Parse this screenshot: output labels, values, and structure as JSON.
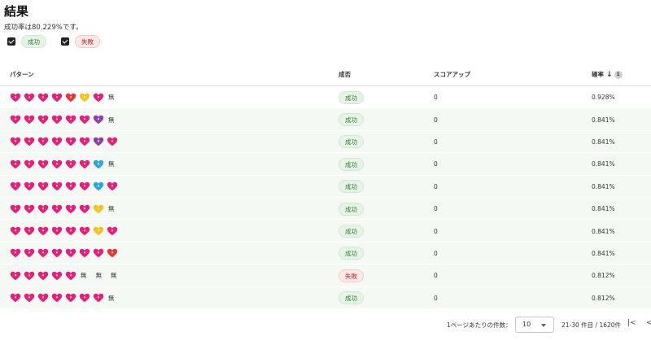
{
  "page": {
    "title": "結果",
    "summary": "成功率は80.229%です。"
  },
  "filters": [
    {
      "label": "成功",
      "checked": true,
      "kind": "success"
    },
    {
      "label": "失敗",
      "checked": true,
      "kind": "fail"
    }
  ],
  "table": {
    "headers": {
      "pattern": "パターン",
      "result": "成否",
      "score_up": "スコアアップ",
      "probability": "確率",
      "sort_order": "1"
    },
    "none_label": "無",
    "rows": [
      {
        "pattern": [
          "pink",
          "pink",
          "pink",
          "pink",
          "red",
          "yellow",
          "pink",
          "none"
        ],
        "result": "成功",
        "kind": "success",
        "score_up": "0",
        "probability": "0.928%"
      },
      {
        "pattern": [
          "pink",
          "pink",
          "pink",
          "pink",
          "pink",
          "pink",
          "purple",
          "none"
        ],
        "result": "成功",
        "kind": "success",
        "score_up": "0",
        "probability": "0.841%"
      },
      {
        "pattern": [
          "pink",
          "pink",
          "pink",
          "pink",
          "pink",
          "pink",
          "purple",
          "pink"
        ],
        "result": "成功",
        "kind": "success",
        "score_up": "0",
        "probability": "0.841%"
      },
      {
        "pattern": [
          "pink",
          "pink",
          "pink",
          "pink",
          "pink",
          "pink",
          "blue",
          "none"
        ],
        "result": "成功",
        "kind": "success",
        "score_up": "0",
        "probability": "0.841%"
      },
      {
        "pattern": [
          "pink",
          "pink",
          "pink",
          "pink",
          "pink",
          "pink",
          "blue",
          "pink"
        ],
        "result": "成功",
        "kind": "success",
        "score_up": "0",
        "probability": "0.841%"
      },
      {
        "pattern": [
          "pink",
          "pink",
          "pink",
          "pink",
          "pink",
          "pink",
          "yellow",
          "none"
        ],
        "result": "成功",
        "kind": "success",
        "score_up": "0",
        "probability": "0.841%"
      },
      {
        "pattern": [
          "pink",
          "pink",
          "pink",
          "pink",
          "pink",
          "pink",
          "yellow",
          "pink"
        ],
        "result": "成功",
        "kind": "success",
        "score_up": "0",
        "probability": "0.841%"
      },
      {
        "pattern": [
          "pink",
          "pink",
          "pink",
          "pink",
          "pink",
          "pink",
          "pink",
          "red"
        ],
        "result": "成功",
        "kind": "success",
        "score_up": "0",
        "probability": "0.841%"
      },
      {
        "pattern": [
          "pink",
          "pink",
          "pink",
          "pink",
          "pink",
          "none",
          "none",
          "none"
        ],
        "result": "失敗",
        "kind": "fail",
        "score_up": "0",
        "probability": "0.812%"
      },
      {
        "pattern": [
          "pink",
          "pink",
          "pink",
          "pink",
          "pink",
          "pink",
          "pink",
          "none"
        ],
        "result": "成功",
        "kind": "success",
        "score_up": "0",
        "probability": "0.812%"
      }
    ]
  },
  "pagination": {
    "rows_per_page_label": "1ページあたりの件数：",
    "rows_per_page": "10",
    "range": "21-30 件目 / 1620件",
    "first_icon": "first-page-icon",
    "prev_icon": "prev-page-icon"
  },
  "colors": {
    "pink": "#e91e78",
    "red": "#e53935",
    "yellow": "#f7c21b",
    "purple": "#8e3fa8",
    "blue": "#29a8e0",
    "success_bg": "#e6f4e7",
    "fail_bg": "#fde8e8",
    "row_tint": "#f4faf3"
  }
}
